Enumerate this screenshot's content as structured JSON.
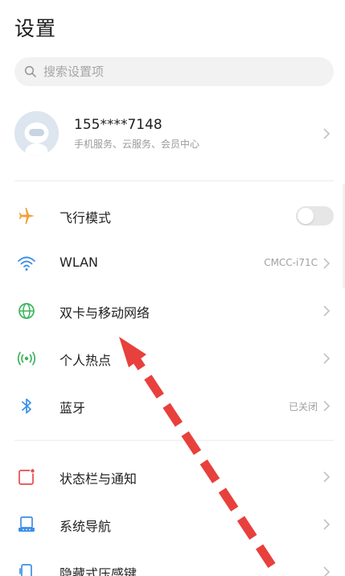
{
  "header": {
    "title": "设置"
  },
  "search": {
    "placeholder": "搜索设置项"
  },
  "account": {
    "name": "155****7148",
    "subtitle": "手机服务、云服务、会员中心"
  },
  "groups": [
    {
      "items": [
        {
          "id": "airplane",
          "label": "飞行模式",
          "icon": "airplane-icon",
          "color": "#f0a03c",
          "control": "toggle",
          "toggle_on": false
        },
        {
          "id": "wlan",
          "label": "WLAN",
          "icon": "wifi-icon",
          "color": "#3b8fe8",
          "value": "CMCC-i71C"
        },
        {
          "id": "dual-sim",
          "label": "双卡与移动网络",
          "icon": "globe-icon",
          "color": "#3cb45c"
        },
        {
          "id": "hotspot",
          "label": "个人热点",
          "icon": "hotspot-icon",
          "color": "#3cb45c"
        },
        {
          "id": "bluetooth",
          "label": "蓝牙",
          "icon": "bluetooth-icon",
          "color": "#3b8fe8",
          "value": "已关闭"
        }
      ]
    },
    {
      "items": [
        {
          "id": "status-bar",
          "label": "状态栏与通知",
          "icon": "status-bar-icon",
          "color": "#e84a4a"
        },
        {
          "id": "navigation",
          "label": "系统导航",
          "icon": "navigation-icon",
          "color": "#3b8fe8"
        },
        {
          "id": "pressure-key",
          "label": "隐藏式压感键",
          "icon": "pressure-key-icon",
          "color": "#3b8fe8"
        }
      ]
    }
  ],
  "annotation": {
    "arrow_color": "#e8403c"
  }
}
